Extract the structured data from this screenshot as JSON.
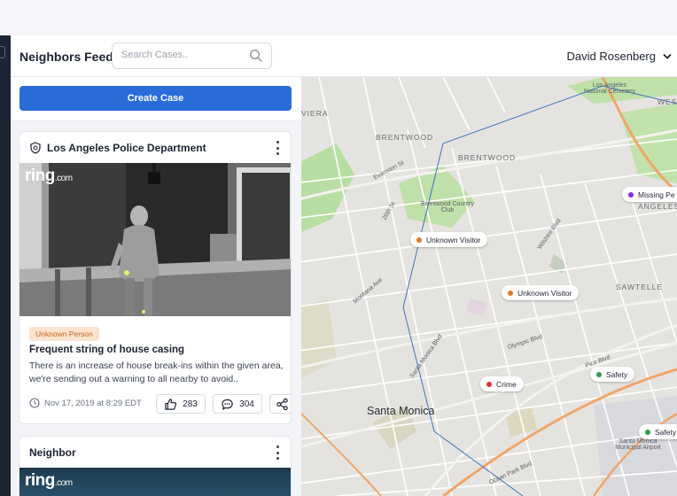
{
  "header": {
    "app_title": "Neighbors Feed",
    "search_placeholder": "Search Cases..",
    "user_name": "David Rosenberg"
  },
  "feed": {
    "create_button": "Create Case",
    "posts": [
      {
        "author": "Los Angeles Police Department",
        "video_brand": "ring",
        "video_brand_suffix": ".com",
        "category": "Unknown Person",
        "title": "Frequent string of house casing",
        "body": "There is an increase of house break-ins within the given area, we're sending out a warning to all nearby to avoid..",
        "date": "Nov 17, 2019 at 8:29 EDT",
        "likes": "283",
        "comments": "304"
      },
      {
        "author": "Neighbor",
        "video_brand": "ring",
        "video_brand_suffix": ".com"
      }
    ]
  },
  "map": {
    "markers": [
      {
        "label": "Unknown Visitor",
        "color": "#e07a1f"
      },
      {
        "label": "Unknown Visitor",
        "color": "#e07a1f"
      },
      {
        "label": "Missing Pe",
        "color": "#8a2be2"
      },
      {
        "label": "Crime",
        "color": "#e0322f"
      },
      {
        "label": "Safety",
        "color": "#2f9e4f"
      },
      {
        "label": "Safety",
        "color": "#2f9e4f"
      }
    ],
    "labels": {
      "santa_monica": "Santa Monica",
      "brentwood_1": "BRENTWOOD",
      "brentwood_2": "BRENTWOOD",
      "sawtelle": "SAWTELLE",
      "angeles": "ANGELES",
      "west": "WEST",
      "viera": "VIERA",
      "cemetery": "Los Angeles National Cemetery",
      "country_club": "Brentwood Country Club",
      "airport": "Santa Monica Municipal Airport",
      "olympic": "Olympic Blvd",
      "wilshire": "Wilshire Blvd",
      "santa_monica_blvd": "Santa Monica Blvd",
      "montana": "Montana Ave",
      "pico": "Pico Blvd",
      "ocean_park": "Ocean Park Blvd",
      "sunset": "Evanston St",
      "san_vicente": "26th St"
    }
  },
  "colors": {
    "accent": "#2a6dd8",
    "badge_bg": "#fbe3d0",
    "badge_text": "#c0651a",
    "rail": "#1c2533"
  }
}
